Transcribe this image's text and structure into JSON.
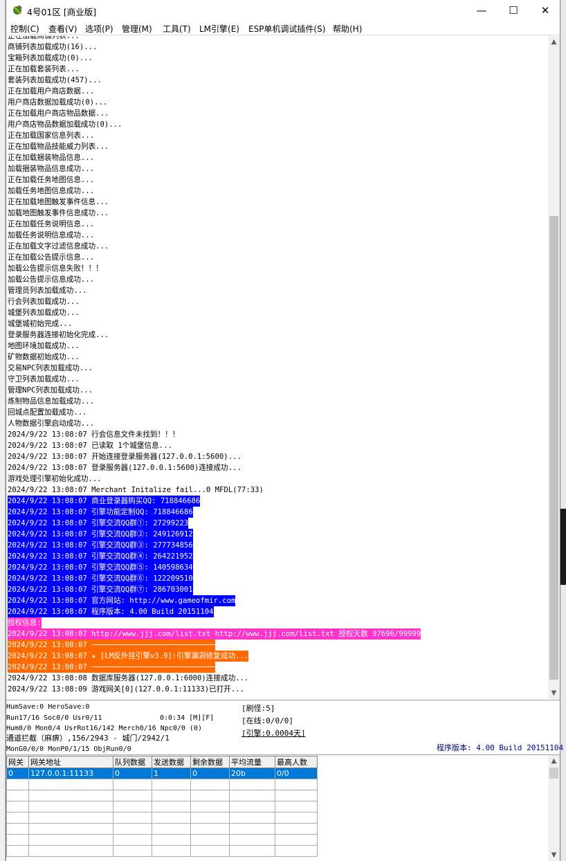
{
  "window": {
    "title": "4号01区 [商业版]",
    "controls": {
      "minimize": "—",
      "maximize": "☐",
      "close": "✕"
    }
  },
  "menu": [
    "控制(C)",
    "查看(V)",
    "选项(P)",
    "管理(M)",
    "工具(T)",
    "LM引擎(E)",
    "ESP单机调试插件(S)",
    "帮助(H)"
  ],
  "log": [
    {
      "text": "正在加载商铺列表...",
      "style": "normal"
    },
    {
      "text": "商铺列表加载成功(16)...",
      "style": "normal"
    },
    {
      "text": "宝箱列表加载成功(0)...",
      "style": "normal"
    },
    {
      "text": "正在加载套装列表...",
      "style": "normal"
    },
    {
      "text": "套装列表加载成功(457)...",
      "style": "normal"
    },
    {
      "text": "正在加载用户商店数据...",
      "style": "normal"
    },
    {
      "text": "用户商店数据加载成功(0)...",
      "style": "normal"
    },
    {
      "text": "正在加载用户商店物品数据...",
      "style": "normal"
    },
    {
      "text": "用户商店物品数据加载成功(0)...",
      "style": "normal"
    },
    {
      "text": "正在加载国家信息列表...",
      "style": "normal"
    },
    {
      "text": "正在加载物品技能威力列表...",
      "style": "normal"
    },
    {
      "text": "正在加载捆装物品信息...",
      "style": "normal"
    },
    {
      "text": "加载捆装物品信息成功...",
      "style": "normal"
    },
    {
      "text": "正在加载任务地图信息...",
      "style": "normal"
    },
    {
      "text": "加载任务地图信息成功...",
      "style": "normal"
    },
    {
      "text": "正在加载地图触发事件信息...",
      "style": "normal"
    },
    {
      "text": "加载地图触发事件信息成功...",
      "style": "normal"
    },
    {
      "text": "正在加载任务说明信息...",
      "style": "normal"
    },
    {
      "text": "加载任务说明信息成功...",
      "style": "normal"
    },
    {
      "text": "正在加载文字过滤信息成功...",
      "style": "normal"
    },
    {
      "text": "正在加载公告提示信息...",
      "style": "normal"
    },
    {
      "text": "加载公告提示信息失败！！！",
      "style": "normal"
    },
    {
      "text": "加载公告提示信息成功...",
      "style": "normal"
    },
    {
      "text": "管理员列表加载成功...",
      "style": "normal"
    },
    {
      "text": "行会列表加载成功...",
      "style": "normal"
    },
    {
      "text": "城堡列表加载成功...",
      "style": "normal"
    },
    {
      "text": "城堡城初始完成...",
      "style": "normal"
    },
    {
      "text": "登录服务器连接初始化完成...",
      "style": "normal"
    },
    {
      "text": "地图环境加载成功...",
      "style": "normal"
    },
    {
      "text": "矿物数据初始成功...",
      "style": "normal"
    },
    {
      "text": "交易NPC列表加载成功...",
      "style": "normal"
    },
    {
      "text": "守卫列表加载成功...",
      "style": "normal"
    },
    {
      "text": "管理NPC列表加载成功...",
      "style": "normal"
    },
    {
      "text": "炼制物品信息加载成功...",
      "style": "normal"
    },
    {
      "text": "回城点配置加载成功...",
      "style": "normal"
    },
    {
      "text": "人物数据引擎启动成功...",
      "style": "normal"
    },
    {
      "text": "2024/9/22 13:08:07 行会信息文件未找到！！！",
      "style": "normal"
    },
    {
      "text": "2024/9/22 13:08:07 已读取 1个城堡信息...",
      "style": "normal"
    },
    {
      "text": "2024/9/22 13:08:07 开始连接登录服务器(127.0.0.1:5600)...",
      "style": "normal"
    },
    {
      "text": "2024/9/22 13:08:07 登录服务器(127.0.0.1:5600)连接成功...",
      "style": "normal"
    },
    {
      "text": "游戏处理引擎初始化成功...",
      "style": "normal"
    },
    {
      "text": "2024/9/22 13:08:07 Merchant Initalize fail...0 MFDL(77:33)",
      "style": "normal"
    },
    {
      "text": "2024/9/22 13:08:07 商业登录器购买QQ: 718846686",
      "style": "hl-blue"
    },
    {
      "text": "2024/9/22 13:08:07 引擎功能定制QQ: 718846686",
      "style": "hl-blue"
    },
    {
      "text": "2024/9/22 13:08:07 引擎交流QQ群①: 27299223",
      "style": "hl-blue"
    },
    {
      "text": "2024/9/22 13:08:07 引擎交流QQ群②: 249126912",
      "style": "hl-blue"
    },
    {
      "text": "2024/9/22 13:08:07 引擎交流QQ群③: 277734856",
      "style": "hl-blue"
    },
    {
      "text": "2024/9/22 13:08:07 引擎交流QQ群④: 264221952",
      "style": "hl-blue"
    },
    {
      "text": "2024/9/22 13:08:07 引擎交流QQ群⑤: 140598634",
      "style": "hl-blue"
    },
    {
      "text": "2024/9/22 13:08:07 引擎交流QQ群⑥: 122209510",
      "style": "hl-blue"
    },
    {
      "text": "2024/9/22 13:08:07 引擎交流QQ群⑦: 286703001",
      "style": "hl-blue"
    },
    {
      "text": "2024/9/22 13:08:07 官方网站: http://www.gameofmir.com",
      "style": "hl-blue"
    },
    {
      "text": "2024/9/22 13:08:07 程序版本: 4.00 Build 20151104",
      "style": "hl-blue"
    },
    {
      "text": "授权信息:",
      "style": "hl-magenta"
    },
    {
      "text": "2024/9/22 13:08:07 http://www.jjj.com/list.txt http://www.jjj.com/list.txt 授权天数 97696/99999",
      "style": "hl-magenta"
    },
    {
      "text": "2024/9/22 13:08:07 ────────────────────────────",
      "style": "hl-orange"
    },
    {
      "text": "2024/9/22 13:08:07 ★ [LM反外挂引擎v3.9]:引擎漏洞修复成功...",
      "style": "hl-orange"
    },
    {
      "text": "2024/9/22 13:08:07 ────────────────────────────",
      "style": "hl-orange"
    },
    {
      "text": "2024/9/22 13:08:08 数据库服务器(127.0.0.1:6000)连接成功...",
      "style": "normal"
    },
    {
      "text": "2024/9/22 13:08:09 游戏网关[0](127.0.0.1:11133)已打开...",
      "style": "normal"
    }
  ],
  "status": {
    "line1": "HumSave:0 HeroSave:0",
    "line2": "Run17/16 Soc0/0 Usr0/11",
    "line2_time": "0:0:34 [M][F]",
    "line3": "Hum0/0 Mon0/4 UsrRot16/142 Merch0/16 Npc0/0 (0)",
    "line4": "通道拦截（麻痹）,156/2943 - 城门/2942/1",
    "line5": "MonG0/0/0 MonP0/1/15 ObjRun0/0",
    "refresh": "[刷怪:5]",
    "online": "[在线:0/0/0]",
    "engine": "[引擎:0.0004天]",
    "version": "程序版本: 4.00 Build 20151104"
  },
  "grid": {
    "columns": [
      "网关",
      "网关地址",
      "队列数据",
      "发送数据",
      "剩余数据",
      "平均流量",
      "最高人数"
    ],
    "rows": [
      [
        "0",
        "127.0.0.1:11133",
        "0",
        "1",
        "0",
        "20b",
        "0/0"
      ]
    ],
    "empty_rows": 7
  }
}
